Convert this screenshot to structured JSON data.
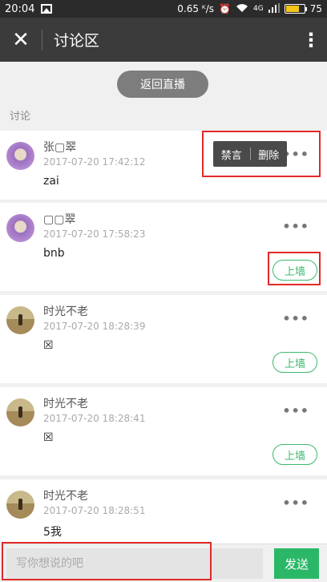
{
  "status_bar": {
    "time": "20:04",
    "net_speed": "0.65 ᴷ/s",
    "network": "4G",
    "battery": "75",
    "battery_level": 0.75
  },
  "header": {
    "close_icon": "close-icon",
    "title": "讨论区",
    "more_icon": "more-vert-icon"
  },
  "back_live_label": "返回直播",
  "section_label": "讨论",
  "moderation_menu": {
    "ban_label": "禁言",
    "delete_label": "删除"
  },
  "comments": [
    {
      "name": "张▢翠",
      "time": "2017-07-20 17:42:12",
      "text": "zai",
      "avatar": "avatar-purple",
      "more": "•••"
    },
    {
      "name": "▢▢翠",
      "time": "2017-07-20 17:58:23",
      "text": "bnb",
      "avatar": "avatar-purple",
      "more": "•••",
      "wall_label": "上墙"
    },
    {
      "name": "时光不老",
      "time": "2017-07-20 18:28:39",
      "text": "☒",
      "avatar": "avatar-field",
      "more": "•••",
      "wall_label": "上墙"
    },
    {
      "name": "时光不老",
      "time": "2017-07-20 18:28:41",
      "text": "☒",
      "avatar": "avatar-field",
      "more": "•••",
      "wall_label": "上墙"
    },
    {
      "name": "时光不老",
      "time": "2017-07-20 18:28:51",
      "text": "5我",
      "avatar": "avatar-field",
      "more": "•••"
    }
  ],
  "composer": {
    "placeholder": "写你想说的吧",
    "value": "",
    "send_label": "发送"
  },
  "colors": {
    "accent_green": "#2bb768",
    "highlight_red": "#e12a2a",
    "header_bg": "#3b3b3b"
  }
}
